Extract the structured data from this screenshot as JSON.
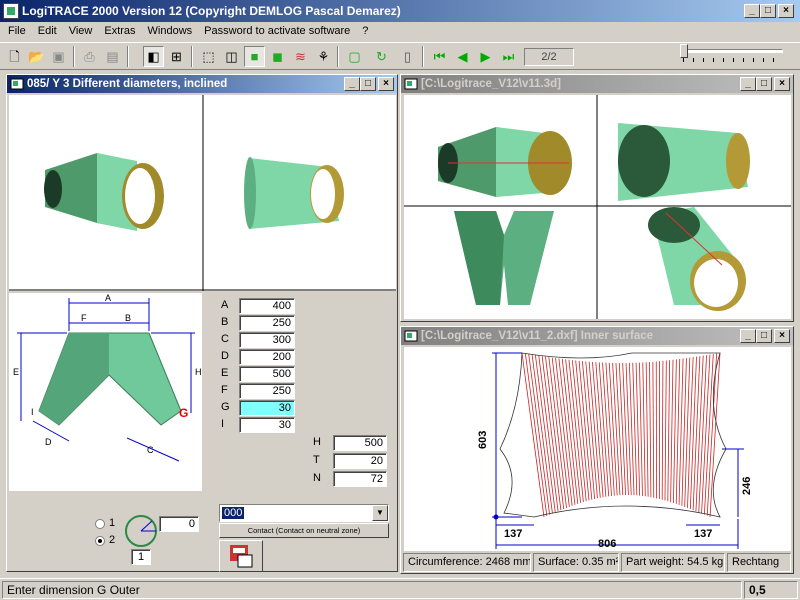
{
  "app": {
    "title": "LogiTRACE 2000  Version 12  (Copyright DEMLOG Pascal Demarez)"
  },
  "menu": [
    "File",
    "Edit",
    "View",
    "Extras",
    "Windows",
    "Password to activate software",
    "?"
  ],
  "toolbar": {
    "page_indicator": "2/2"
  },
  "left_window": {
    "title": "085/ Y 3 Different diameters, inclined",
    "dims": [
      {
        "label": "A",
        "value": "400"
      },
      {
        "label": "B",
        "value": "250"
      },
      {
        "label": "C",
        "value": "300"
      },
      {
        "label": "D",
        "value": "200"
      },
      {
        "label": "E",
        "value": "500"
      },
      {
        "label": "F",
        "value": "250"
      },
      {
        "label": "G",
        "value": "30"
      },
      {
        "label": "I",
        "value": "30"
      }
    ],
    "dims2": [
      {
        "label": "H",
        "value": "500"
      },
      {
        "label": "T",
        "value": "20"
      },
      {
        "label": "N",
        "value": "72"
      }
    ],
    "drawing_labels": {
      "A": "A",
      "B": "B",
      "C": "C",
      "D": "D",
      "E": "E",
      "F": "F",
      "G": "G",
      "H": "H",
      "I": "I"
    },
    "radio1": "1",
    "radio2": "2",
    "angle_value": "0",
    "count_value": "1",
    "combo_value": "000",
    "contact_button": "Contact (Contact on neutral zone)"
  },
  "right_top_window": {
    "title": "[C:\\Logitrace_V12\\v11.3d]"
  },
  "right_bottom_window": {
    "title": "[C:\\Logitrace_V12\\v11_2.dxf]  Inner surface",
    "dim_height": "603",
    "dim_side": "246",
    "dim_left": "137",
    "dim_right": "137",
    "dim_width": "806"
  },
  "info": {
    "circumference": "Circumference: 2468 mm",
    "surface": "Surface: 0.35 m²",
    "weight": "Part weight: 54.5 kg",
    "extra": "Rechtang"
  },
  "status": {
    "message": "Enter dimension G Outer",
    "value": "0,5"
  },
  "colors": {
    "pipe": "#6fc99a",
    "inner": "#b8a040",
    "title_active": "#0a246a",
    "highlight": "#80ffff",
    "dxf_line": "#cc2222",
    "dim_blue": "#0000cc"
  }
}
